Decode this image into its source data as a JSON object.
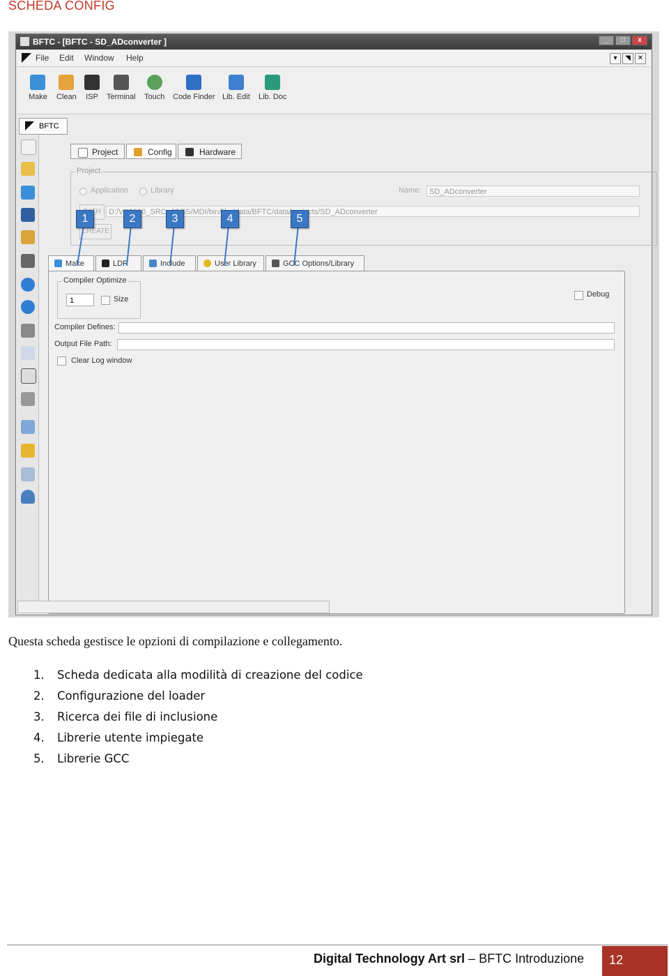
{
  "section_title": "SCHEDA CONFIG",
  "window": {
    "title": "BFTC - [BFTC - SD_ADconverter ]",
    "controls": {
      "minimize": "_",
      "maximize": "□",
      "close": "x"
    }
  },
  "menu": [
    "File",
    "Edit",
    "Window",
    "Help"
  ],
  "mdi_controls": [
    "▾",
    "◥",
    "✕"
  ],
  "toolbar": [
    {
      "label": "Make",
      "icon": "make-icon",
      "color": "#3a8fd8"
    },
    {
      "label": "Clean",
      "icon": "clean-icon",
      "color": "#e6a23c"
    },
    {
      "label": "ISP",
      "icon": "isp-icon",
      "color": "#333333"
    },
    {
      "label": "Terminal",
      "icon": "terminal-icon",
      "color": "#555555"
    },
    {
      "label": "Touch",
      "icon": "touch-icon",
      "color": "#5aa05a"
    },
    {
      "label": "Code Finder",
      "icon": "code-finder-icon",
      "color": "#2d6fc4"
    },
    {
      "label": "Lib. Edit",
      "icon": "lib-edit-icon",
      "color": "#3f7fcf"
    },
    {
      "label": "Lib. Doc",
      "icon": "lib-doc-icon",
      "color": "#2a9a7a"
    }
  ],
  "doc_tab": "BFTC",
  "main_tabs": [
    "Project",
    "Config",
    "Hardware"
  ],
  "project_group": {
    "legend": "Project",
    "app_radio": "Application",
    "lib_radio": "Library",
    "name_label": "Name:",
    "name_value": "SD_ADconverter",
    "path_button": "PATH",
    "path_value": "D:/VS2010_SRC_JOBS/MDI/bin/libs/data/BFTC/data/projects/SD_ADconverter",
    "create_button": "CREATE"
  },
  "sub_tabs": [
    "Make",
    "LDR",
    "Include",
    "User Library",
    "GCC Options/Library"
  ],
  "make_panel": {
    "compiler_optimize": "Compiler Optimize",
    "optimize_value": "1",
    "size_label": "Size",
    "debug_label": "Debug",
    "compiler_defines": "Compiler Defines:",
    "output_file_path": "Output File Path:",
    "clear_log": "Clear Log window"
  },
  "callouts": [
    "1",
    "2",
    "3",
    "4",
    "5"
  ],
  "description": "Questa scheda gestisce le opzioni di compilazione e collegamento.",
  "items": [
    {
      "num": "1.",
      "text": "Scheda dedicata alla modilità di creazione del codice"
    },
    {
      "num": "2.",
      "text": "Configurazione del loader"
    },
    {
      "num": "3.",
      "text": "Ricerca dei file di inclusione"
    },
    {
      "num": "4.",
      "text": "Librerie utente impiegate"
    },
    {
      "num": "5.",
      "text": "Librerie GCC"
    }
  ],
  "footer": {
    "company": "Digital Technology Art srl",
    "separator": "–",
    "doc": "BFTC Introduzione",
    "page": "12"
  },
  "colors": {
    "accent_red": "#a93226",
    "callout_blue": "#3b78c4"
  }
}
